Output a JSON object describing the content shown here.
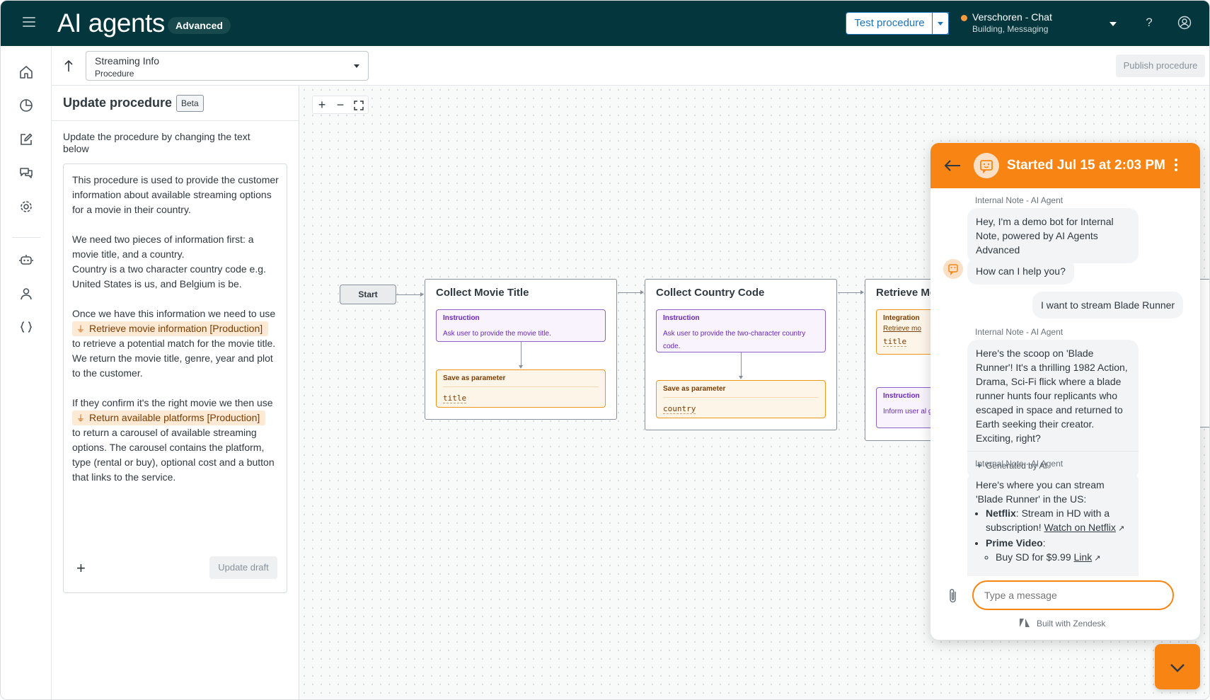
{
  "header": {
    "app_title": "AI agents",
    "tier_badge": "Advanced",
    "test_button_label": "Test procedure",
    "channel_name": "Verschoren - Chat",
    "channel_sub": "Building, Messaging",
    "status_color": "#f79a3e"
  },
  "subheader": {
    "procedure_name": "Streaming Info",
    "procedure_type": "Procedure",
    "publish_label": "Publish procedure"
  },
  "nav_icons": [
    "home-icon",
    "analytics-icon",
    "edit-icon",
    "conversations-icon",
    "settings-icon",
    "bot-icon",
    "user-icon",
    "code-braces-icon"
  ],
  "panel": {
    "title": "Update procedure",
    "badge": "Beta",
    "description": "Update the procedure by changing the text below",
    "editor": {
      "p1": "This procedure is used to provide the customer information about available streaming options for a movie in their country.",
      "p2a": "We need two pieces of information first: a movie title, and a country.",
      "p2b": "Country is a two character country code e.g. United States is us, and Belgium is be.",
      "p3a": "Once we have this information we need to use",
      "chip1": "Retrieve movie information [Production]",
      "p3b": "to retrieve a potential match for the movie title. We return the movie title, genre, year and plot to the customer.",
      "p4a": "If they confirm it's the right movie we then use",
      "chip2": "Return available platforms [Production]",
      "p4b": "to return a carousel of available streaming options. The carousel contains the platform, type (rental or buy), optional cost and a button that links to the service."
    },
    "update_label": "Update draft"
  },
  "canvas": {
    "zoom_in": "+",
    "zoom_out": "−",
    "start_label": "Start",
    "steps": [
      {
        "title": "Collect Movie Title",
        "instruction_label": "Instruction",
        "instruction_text": "Ask user to provide the movie title.",
        "save_label": "Save as parameter",
        "param": "title"
      },
      {
        "title": "Collect Country Code",
        "instruction_label": "Instruction",
        "instruction_text": "Ask user to provide the two-character country code.",
        "save_label": "Save as parameter",
        "param": "country"
      },
      {
        "title": "Retrieve Mo",
        "integration_label": "Integration",
        "integration_link": "Retrieve mo",
        "param": "title",
        "instruction_label": "Instruction",
        "instruction_text": "Inform user al genre, year, a"
      }
    ]
  },
  "chat": {
    "title": "Started Jul 15 at 2:03 PM",
    "note_label": "Internal Note - AI Agent",
    "msg1": "Hey, I'm a demo bot for Internal Note, powered by AI Agents Advanced",
    "msg2": "How can I help you?",
    "user_msg": "I want to stream Blade Runner",
    "msg3": "Here's the scoop on 'Blade Runner'! It's a thrilling 1982 Action, Drama, Sci-Fi flick where a blade runner hunts four replicants who escaped in space and returned to Earth seeking their creator. Exciting, right?",
    "generated": "Generated by AI",
    "msg4_intro": "Here's where you can stream 'Blade Runner' in the US:",
    "netflix_name": "Netflix",
    "netflix_text": ": Stream in HD with a subscription!",
    "netflix_link": "Watch on Netflix",
    "prime_name": "Prime Video",
    "prime_item": "Buy SD for $9.99",
    "prime_link": "Link",
    "input_placeholder": "Type a message",
    "built_with": "Built with Zendesk",
    "accent": "#f88414"
  }
}
